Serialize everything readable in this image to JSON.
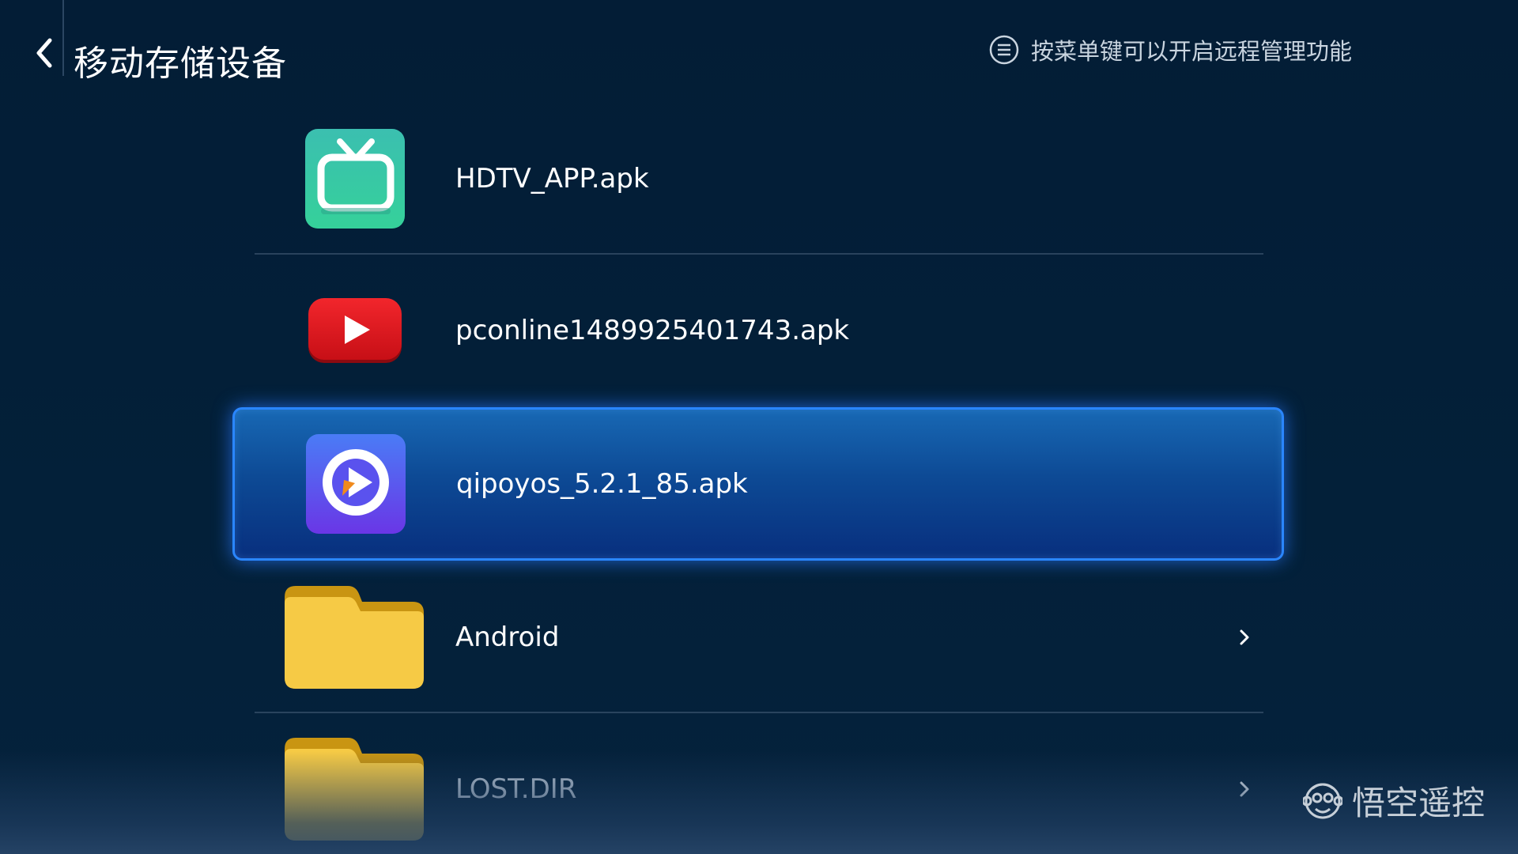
{
  "header": {
    "back_icon": "chevron-left-icon",
    "title": "移动存储设备",
    "hint_icon": "menu-circle-icon",
    "hint_text": "按菜单键可以开启远程管理功能"
  },
  "files": [
    {
      "name": "HDTV_APP.apk",
      "icon": "tv-app-icon",
      "type": "apk"
    },
    {
      "name": "pconline1489925401743.apk",
      "icon": "youtube-play-icon",
      "type": "apk"
    },
    {
      "name": "qipoyos_5.2.1_85.apk",
      "icon": "qipo-player-icon",
      "type": "apk",
      "selected": true
    },
    {
      "name": "Android",
      "icon": "folder-icon",
      "type": "folder"
    },
    {
      "name": "LOST.DIR",
      "icon": "folder-icon",
      "type": "folder"
    }
  ],
  "watermark": {
    "text": "悟空遥控",
    "icon": "monkey-logo-icon"
  },
  "colors": {
    "background": "#03203a",
    "selection_border": "#2a86ff",
    "folder": "#f6ca45",
    "youtube_red": "#e3151c",
    "tv_teal": "#3ec6a8",
    "qipo_purple": "#5b4cf0"
  }
}
